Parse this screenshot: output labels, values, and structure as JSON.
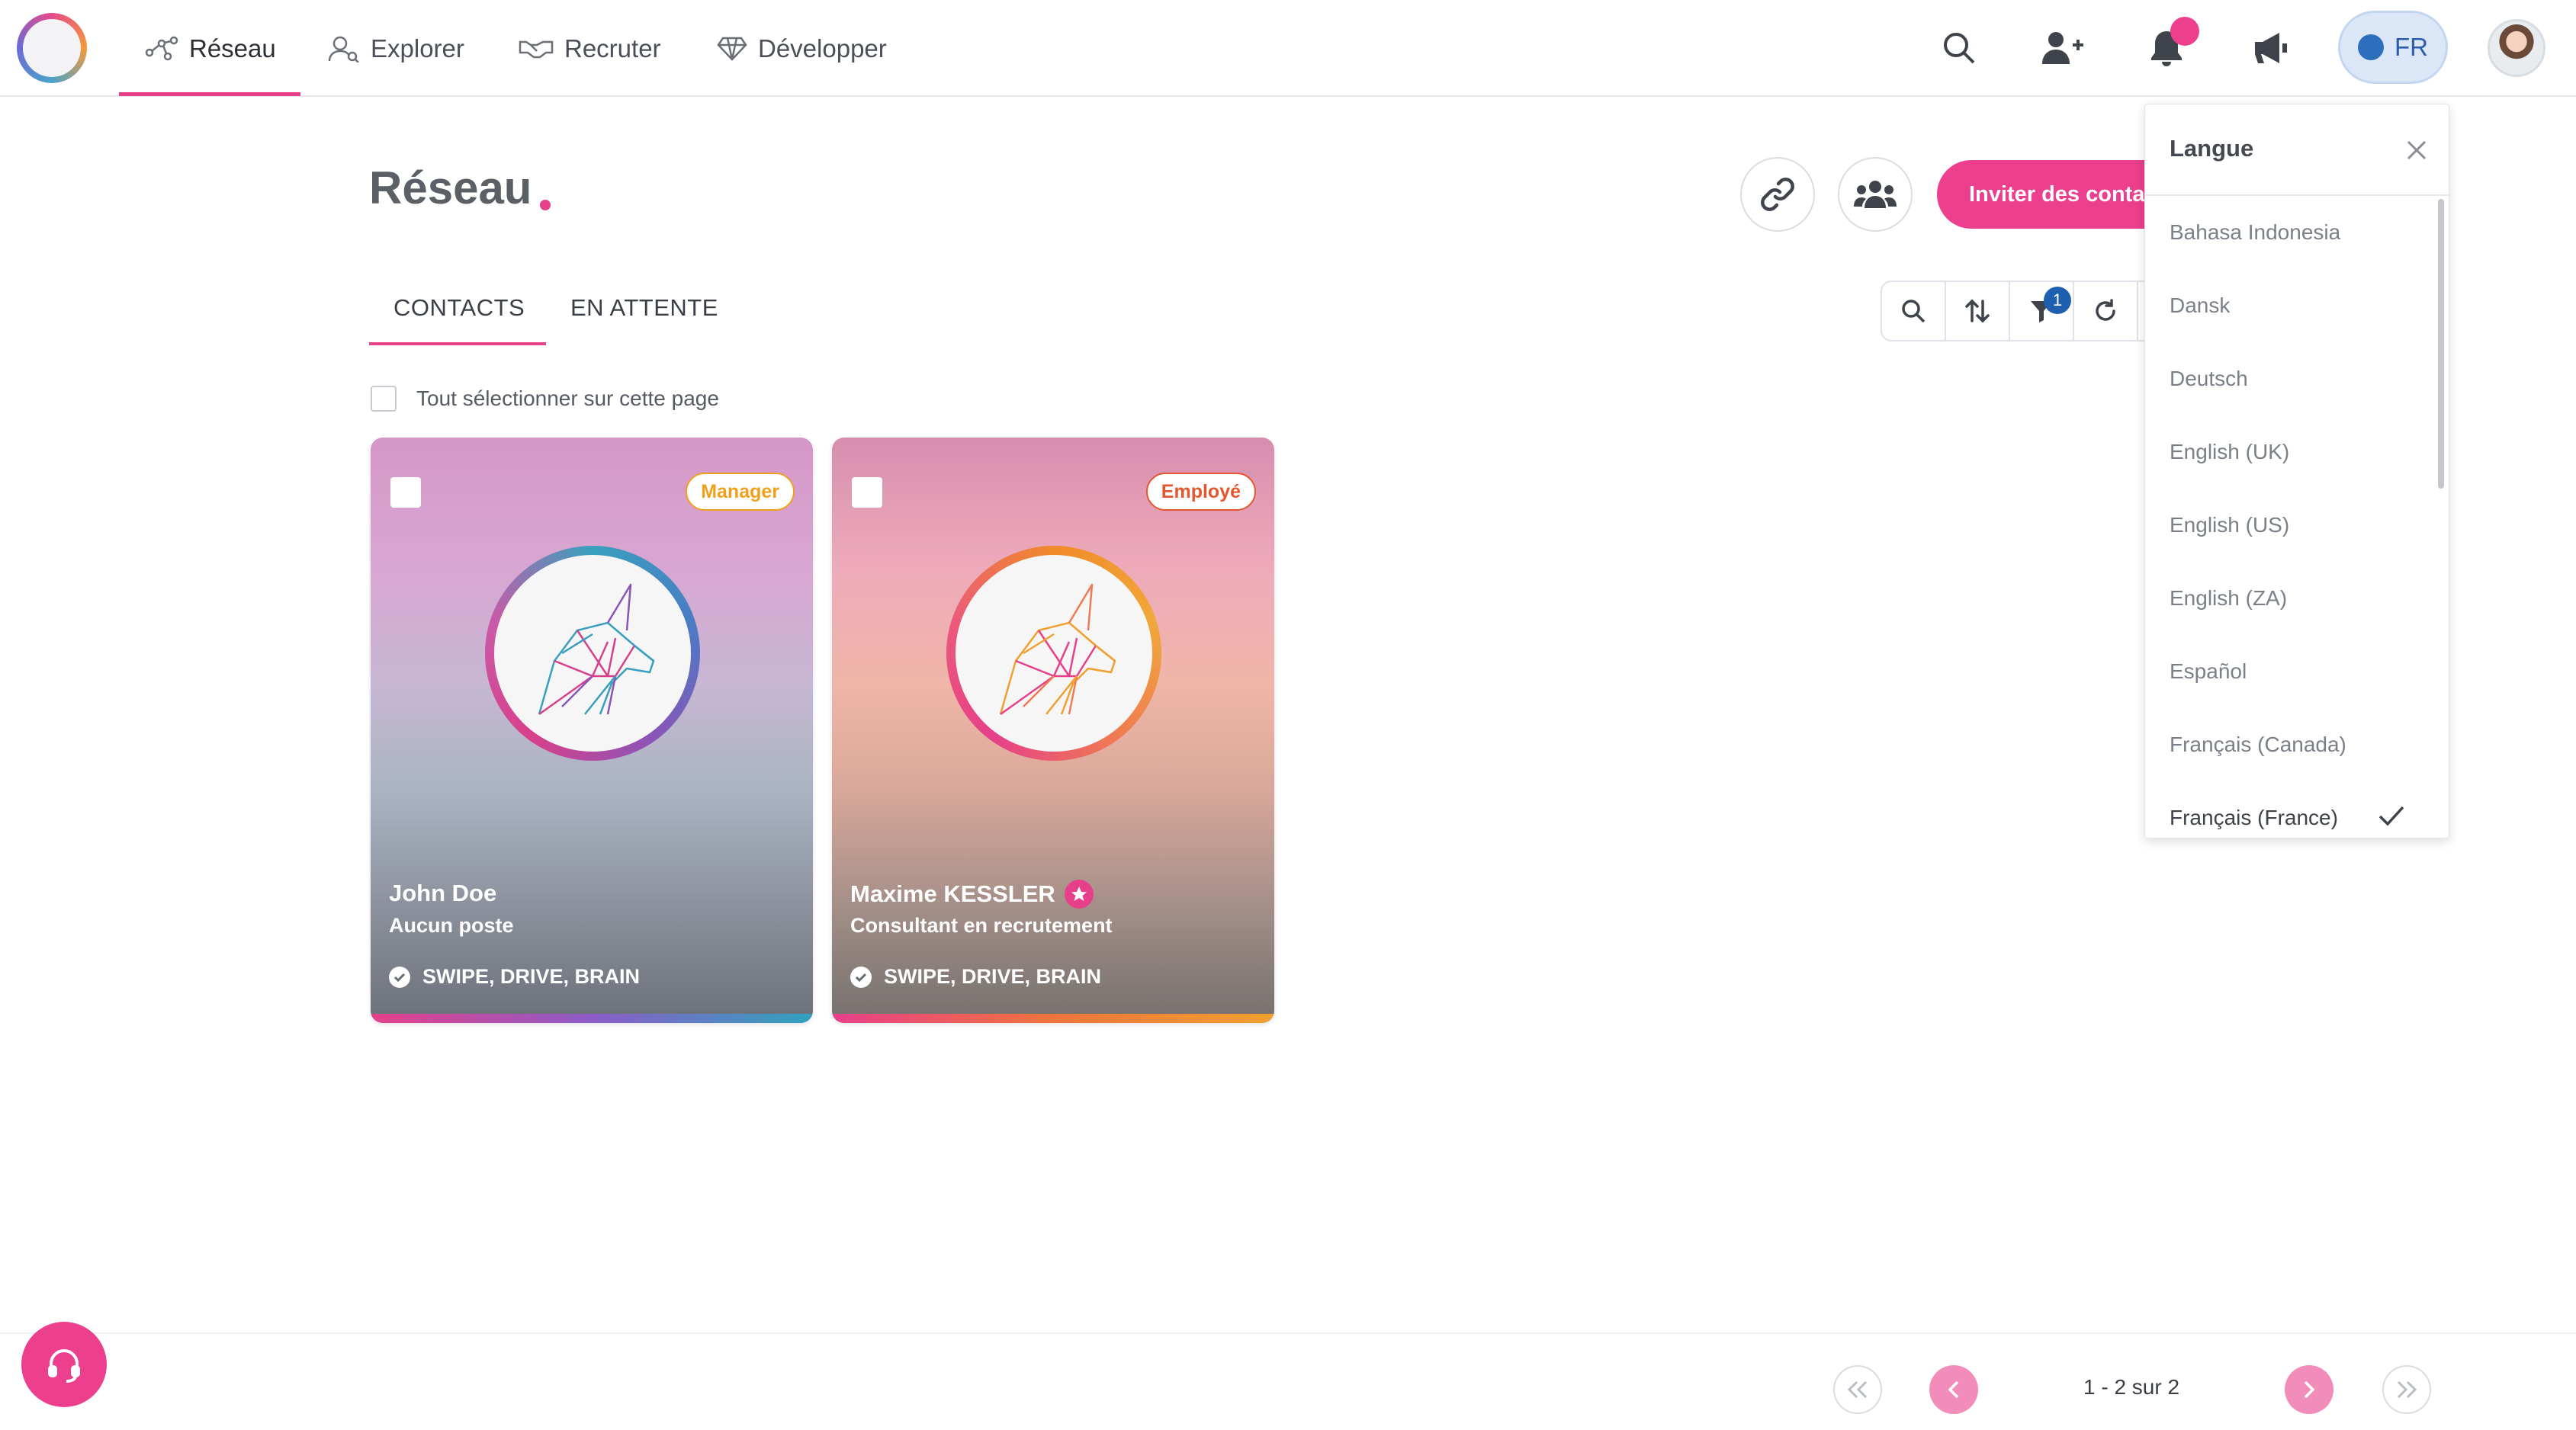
{
  "nav": {
    "items": [
      {
        "label": "Réseau",
        "icon": "network-icon",
        "active": true
      },
      {
        "label": "Explorer",
        "icon": "people-search-icon",
        "active": false
      },
      {
        "label": "Recruter",
        "icon": "handshake-icon",
        "active": false
      },
      {
        "label": "Développer",
        "icon": "diamond-icon",
        "active": false
      }
    ],
    "actions": [
      "search-icon",
      "add-user-icon",
      "bell-icon",
      "megaphone-icon"
    ],
    "language_button": "FR",
    "notification_dot_color": "#ec3f8d"
  },
  "page": {
    "title": "Réseau",
    "invite_button": "Inviter des contacts",
    "tabs": [
      {
        "label": "CONTACTS",
        "active": true
      },
      {
        "label": "EN ATTENTE",
        "active": false
      }
    ],
    "toolbar": {
      "filter_count": "1"
    },
    "select_all_label": "Tout sélectionner sur cette page"
  },
  "cards": [
    {
      "name": "John Doe",
      "role": "Aucun poste",
      "badge": "Manager",
      "skills": "SWIPE, DRIVE, BRAIN",
      "starred": false
    },
    {
      "name": "Maxime KESSLER",
      "role": "Consultant en recrutement",
      "badge": "Employé",
      "skills": "SWIPE, DRIVE, BRAIN",
      "starred": true
    }
  ],
  "language_panel": {
    "title": "Langue",
    "options": [
      {
        "label": "Bahasa Indonesia",
        "selected": false
      },
      {
        "label": "Dansk",
        "selected": false
      },
      {
        "label": "Deutsch",
        "selected": false
      },
      {
        "label": "English (UK)",
        "selected": false
      },
      {
        "label": "English (US)",
        "selected": false
      },
      {
        "label": "English (ZA)",
        "selected": false
      },
      {
        "label": "Español",
        "selected": false
      },
      {
        "label": "Français (Canada)",
        "selected": false
      },
      {
        "label": "Français (France)",
        "selected": true
      }
    ]
  },
  "pagination": {
    "summary": "1 - 2 sur 2"
  },
  "colors": {
    "accent": "#ec3f8d",
    "badge_blue": "#1f5fb0"
  }
}
